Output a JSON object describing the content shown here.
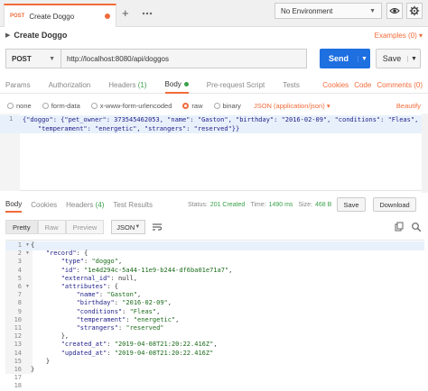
{
  "tabbar": {
    "tab_method": "POST",
    "tab_title": "Create Doggo",
    "environment": "No Environment"
  },
  "request": {
    "name": "Create Doggo",
    "examples": "Examples (0)",
    "method": "POST",
    "url": "http://localhost:8080/api/doggos",
    "send_label": "Send",
    "save_label": "Save"
  },
  "request_tabs": {
    "params": "Params",
    "authorization": "Authorization",
    "headers": "Headers",
    "headers_count": "(1)",
    "body": "Body",
    "prerequest": "Pre-request Script",
    "tests": "Tests",
    "cookies": "Cookies",
    "code": "Code",
    "comments": "Comments (0)"
  },
  "body_types": {
    "none": "none",
    "form_data": "form-data",
    "urlencoded": "x-www-form-urlencoded",
    "raw": "raw",
    "binary": "binary",
    "content_type": "JSON (application/json)",
    "beautify": "Beautify"
  },
  "request_body": {
    "line_number": "1",
    "line1": "{\"doggo\": {\"pet_owner\": 373545462053, \"name\": \"Gaston\", \"birthday\": \"2016-02-09\", \"conditions\": \"Fleas\",",
    "line2": "\"temperament\": \"energetic\", \"strangers\": \"reserved\"}}"
  },
  "response_tabs": {
    "body": "Body",
    "cookies": "Cookies",
    "headers": "Headers",
    "headers_count": "(4)",
    "test_results": "Test Results",
    "status_label": "Status:",
    "status_value": "201 Created",
    "time_label": "Time:",
    "time_value": "1490 ms",
    "size_label": "Size:",
    "size_value": "468 B",
    "save_label": "Save",
    "download_label": "Download"
  },
  "response_toolbar": {
    "pretty": "Pretty",
    "raw": "Raw",
    "preview": "Preview",
    "format": "JSON"
  },
  "response_body": {
    "line_numbers": "1\n2\n3\n4\n5\n6\n7\n8\n9\n10\n11\n12\n13\n14\n15\n16\n17\n18",
    "lines": [
      "{",
      "    \"record\": {",
      "        \"type\": \"doggo\",",
      "        \"id\": \"1e4d294c-5a44-11e9-b244-df6ba01e71a7\",",
      "        \"external_id\": null,",
      "        \"attributes\": {",
      "            \"name\": \"Gaston\",",
      "            \"birthday\": \"2016-02-09\",",
      "            \"conditions\": \"Fleas\",",
      "            \"temperament\": \"energetic\",",
      "            \"strangers\": \"reserved\"",
      "        },",
      "        \"created_at\": \"2019-04-08T21:20:22.416Z\",",
      "        \"updated_at\": \"2019-04-08T21:20:22.416Z\"",
      "    }",
      "}",
      "",
      ""
    ]
  },
  "colors": {
    "accent": "#f26b3a",
    "primary": "#1e6fe0",
    "success": "#3aa14a"
  }
}
